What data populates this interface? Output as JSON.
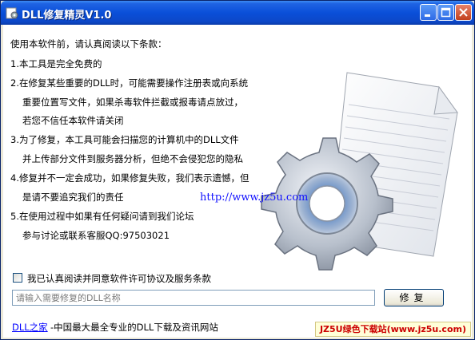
{
  "window": {
    "title": "DLL修复精灵V1.0"
  },
  "titlebar": {
    "minimize_icon": "minimize-icon",
    "maximize_icon": "maximize-icon",
    "close_icon": "close-icon"
  },
  "notice": {
    "intro": "使用本软件前，请认真阅读以下条款：",
    "lines": [
      "1.本工具是完全免费的",
      "2.在修复某些重要的DLL时，可能需要操作注册表或向系统",
      "重要位置写文件，如果杀毒软件拦截或报毒请点放过，",
      "若您不信任本软件请关闭",
      "3.为了修复，本工具可能会扫描您的计算机中的DLL文件",
      "并上传部分文件到服务器分析，但绝不会侵犯您的隐私",
      "4.修复并不一定会成功，如果修复失败，我们表示遗憾，但",
      "是请不要追究我们的责任",
      "5.在使用过程中如果有任何疑问请到我们论坛",
      "参与讨论或联系客服QQ:97503021"
    ]
  },
  "illustration": {
    "url": "http://www.jz5u.com",
    "icon": "document-gear-icon"
  },
  "agreement": {
    "label": "我已认真阅读并同意软件许可协议及服务条款",
    "checked": false
  },
  "dll_input": {
    "value": "",
    "placeholder": "请输入需要修复的DLL名称"
  },
  "repair_button": {
    "label": "修复"
  },
  "footer": {
    "link": "DLL之家",
    "text": "-中国最大最全专业的DLL下载及资讯网站"
  },
  "watermark": {
    "text": "JZ5U绿色下载站(www.jz5u.com)"
  },
  "colors": {
    "titlebar": "#0a4fd9",
    "link": "#0000ff",
    "url": "#1010ff",
    "watermark": "#cc0000"
  }
}
